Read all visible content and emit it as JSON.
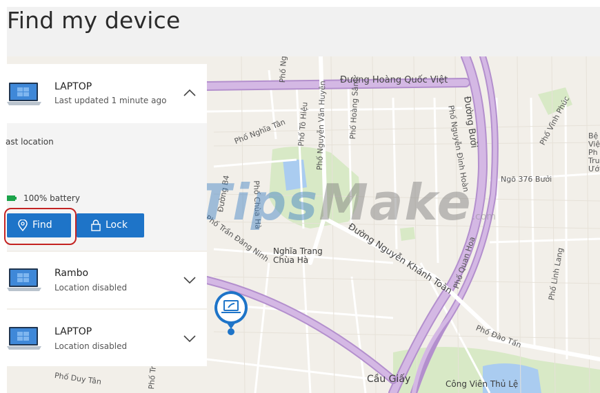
{
  "page_title": "Find my device",
  "devices": [
    {
      "name": "LAPTOP",
      "status": "Last updated 1 minute ago"
    },
    {
      "name": "Rambo",
      "status": "Location disabled"
    },
    {
      "name": "LAPTOP",
      "status": "Location disabled"
    }
  ],
  "details": {
    "last_location_label": "ast location",
    "battery": "100% battery",
    "find_label": "Find",
    "lock_label": "Lock"
  },
  "map": {
    "streets": [
      "Đường Hoàng Quốc Việt",
      "Phố Nguyễn Văn Huyên",
      "Phố Nghĩa Tân",
      "Phố Tô Hiệu",
      "Phố Hoàng Sâm",
      "Phố Nguyễn Đình Hoàn",
      "Đường Bưởi",
      "Phố Vĩnh Phúc",
      "Ngõ 376 Bưởi",
      "Phố Chùa Hà",
      "Đường B4",
      "Phố Trần Đăng Ninh",
      "Đường Nguyễn Khánh Toàn",
      "Phố Quan Hoa",
      "Phố Linh Lang",
      "Phố Đào Tấn",
      "Phố Duy Tân",
      "Phố Trần",
      "Phố Ng",
      "Bệ Việ Ph Tru Ướ"
    ],
    "places": [
      "Nghĩa Trang Chùa Hà",
      "Cầu Giấy",
      "Công Viên Thủ Lệ"
    ],
    "colors": {
      "road_major": "#d4b8e4",
      "road_major_edge": "#b38fcd",
      "park": "#d8e9c6",
      "water": "#aaccf0",
      "land": "#f2efe9",
      "minor_road": "#ffffff"
    }
  },
  "watermark": {
    "part1": "Tips",
    "part2": "Make",
    "suffix": ".com"
  },
  "colors": {
    "accent": "#1e74c8",
    "highlight": "#c32222",
    "header_bg": "#f1f1f1"
  }
}
